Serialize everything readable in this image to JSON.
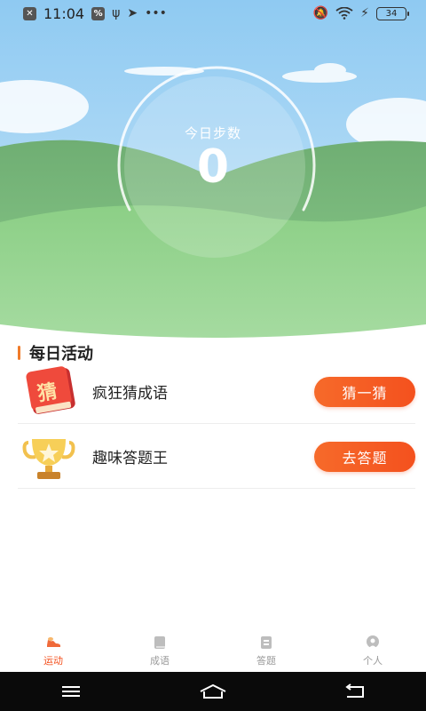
{
  "status_bar": {
    "time": "11:04",
    "battery": "34"
  },
  "hero": {
    "steps_label": "今日步数",
    "steps_value": "0"
  },
  "activities": {
    "title": "每日活动",
    "items": [
      {
        "name": "疯狂猜成语",
        "button": "猜一猜",
        "badge": "猜",
        "icon": "red-book-icon"
      },
      {
        "name": "趣味答题王",
        "button": "去答题",
        "icon": "trophy-icon"
      }
    ]
  },
  "tabs": [
    {
      "label": "运动",
      "icon": "sneaker-icon",
      "active": true
    },
    {
      "label": "成语",
      "icon": "book-icon",
      "active": false
    },
    {
      "label": "答题",
      "icon": "quiz-icon",
      "active": false
    },
    {
      "label": "个人",
      "icon": "person-icon",
      "active": false
    }
  ],
  "colors": {
    "accent": "#f4511e",
    "sky": "#a9d6f5",
    "grass": "#7fc27f"
  }
}
